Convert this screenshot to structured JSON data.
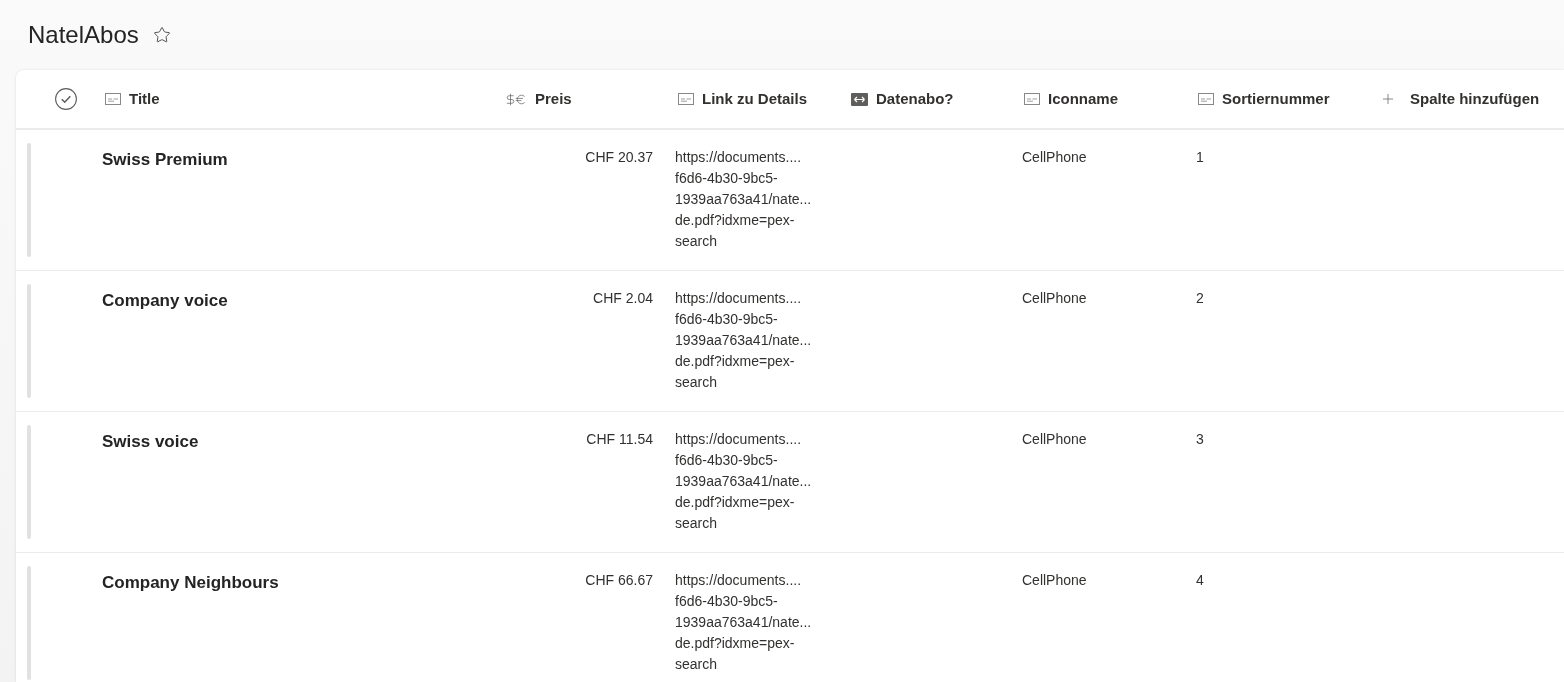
{
  "page": {
    "title": "NatelAbos",
    "favorite": false
  },
  "table": {
    "select_all": {
      "checked": false
    },
    "columns": [
      {
        "label": "Title",
        "kind": "text"
      },
      {
        "label": "Preis",
        "kind": "currency"
      },
      {
        "label": "Link zu Details",
        "kind": "text"
      },
      {
        "label": "Datenabo?",
        "kind": "yesno"
      },
      {
        "label": "Iconname",
        "kind": "text"
      },
      {
        "label": "Sortiernummer",
        "kind": "text"
      }
    ],
    "add_column": {
      "label": "Spalte hinzufügen"
    },
    "rows": [
      {
        "title": "Swiss Premium",
        "preis": "CHF 20.37",
        "link": "https://documents....\nf6d6-4b30-9bc5-\n1939aa763a41/nate...\nde.pdf?idxme=pex-\nsearch",
        "iconname": "CellPhone",
        "sortiernummer": "1"
      },
      {
        "title": "Company voice",
        "preis": "CHF 2.04",
        "link": "https://documents....\nf6d6-4b30-9bc5-\n1939aa763a41/nate...\nde.pdf?idxme=pex-\nsearch",
        "iconname": "CellPhone",
        "sortiernummer": "2"
      },
      {
        "title": "Swiss voice",
        "preis": "CHF 11.54",
        "link": "https://documents....\nf6d6-4b30-9bc5-\n1939aa763a41/nate...\nde.pdf?idxme=pex-\nsearch",
        "iconname": "CellPhone",
        "sortiernummer": "3"
      },
      {
        "title": "Company Neighbours",
        "preis": "CHF 66.67",
        "link": "https://documents....\nf6d6-4b30-9bc5-\n1939aa763a41/nate...\nde.pdf?idxme=pex-\nsearch",
        "iconname": "CellPhone",
        "sortiernummer": "4"
      }
    ]
  }
}
